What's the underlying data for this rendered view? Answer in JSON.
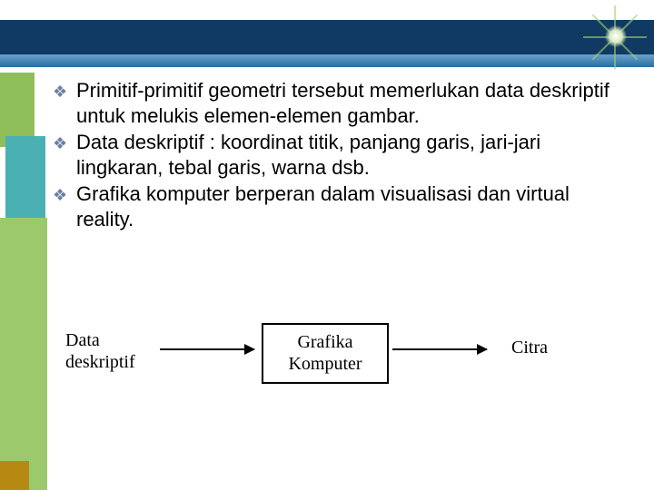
{
  "bullets": {
    "b1": "Primitif-primitif geometri tersebut memerlukan data deskriptif untuk melukis elemen-elemen gambar.",
    "b2": " Data deskriptif : koordinat titik, panjang garis, jari-jari lingkaran, tebal garis, warna dsb.",
    "b3": " Grafika komputer berperan dalam visualisasi dan virtual reality."
  },
  "diagram": {
    "data_label": "Data\ndeskriptif",
    "grafika_label": "Grafika\nKomputer",
    "citra_label": "Citra"
  }
}
